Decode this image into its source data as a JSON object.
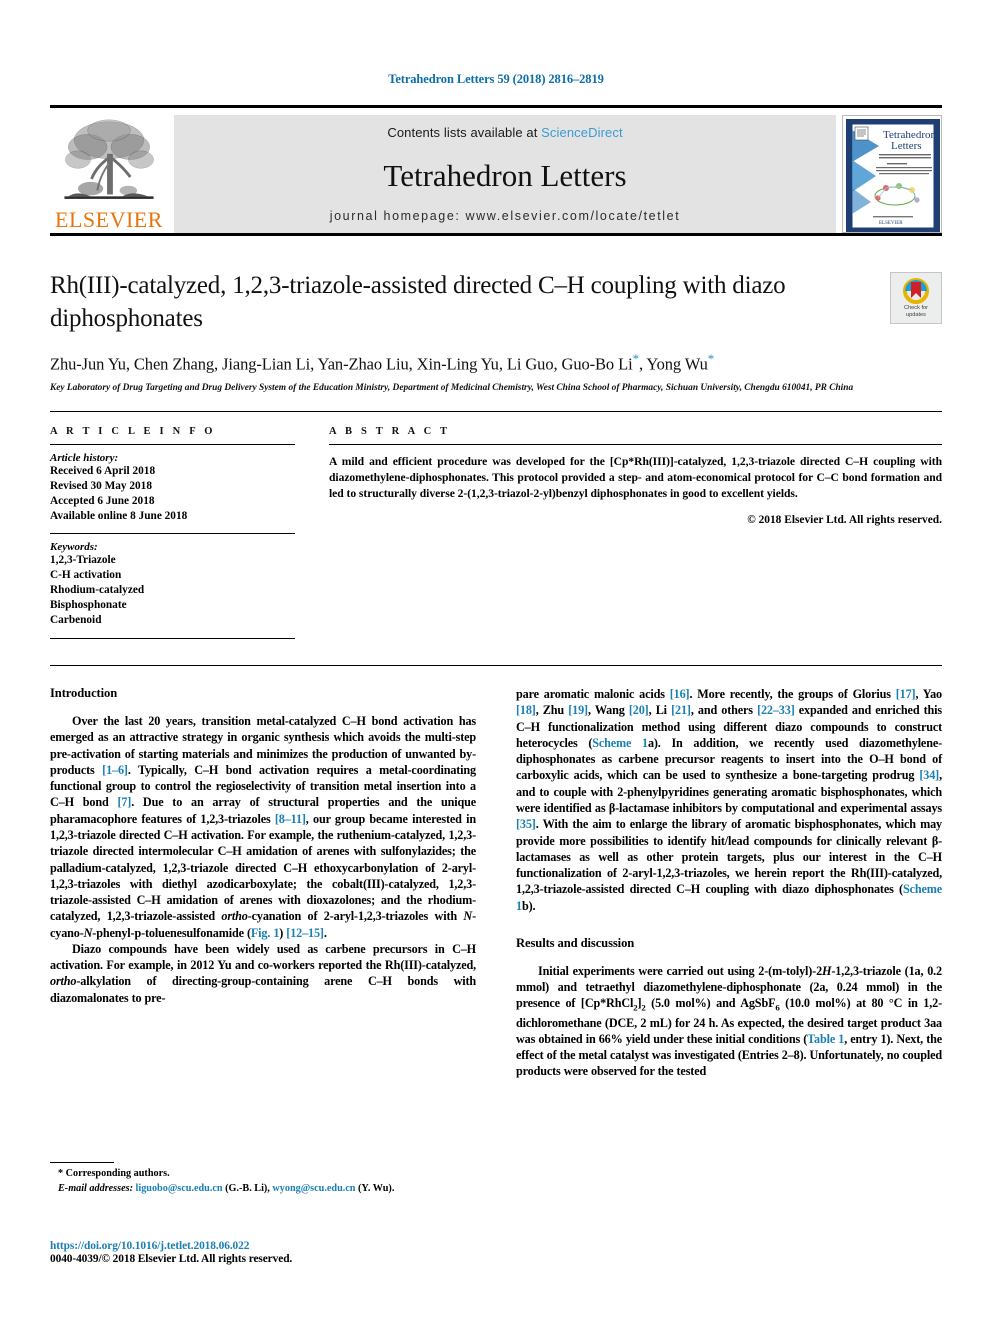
{
  "running_head": "Tetrahedron Letters 59 (2018) 2816–2819",
  "masthead": {
    "publisher_name": "ELSEVIER",
    "contents_prefix": "Contents lists available at ",
    "sciencedirect": "ScienceDirect",
    "journal_title": "Tetrahedron Letters",
    "homepage": "journal homepage: www.elsevier.com/locate/tetlet",
    "cover_title_line1": "Tetrahedron",
    "cover_title_line2": "Letters"
  },
  "article": {
    "title": "Rh(III)-catalyzed, 1,2,3-triazole-assisted directed C–H coupling with diazo diphosphonates",
    "crossmark_label_line1": "Check for",
    "crossmark_label_line2": "updates",
    "authors": "Zhu-Jun Yu, Chen Zhang, Jiang-Lian Li, Yan-Zhao Liu, Xin-Ling Yu, Li Guo, Guo-Bo Li",
    "authors_tail": ", Yong Wu",
    "affiliation": "Key Laboratory of Drug Targeting and Drug Delivery System of the Education Ministry, Department of Medicinal Chemistry, West China School of Pharmacy, Sichuan University, Chengdu 610041, PR China"
  },
  "article_info": {
    "heading": "A R T I C L E   I N F O",
    "history_label": "Article history:",
    "history": [
      "Received 6 April 2018",
      "Revised 30 May 2018",
      "Accepted 6 June 2018",
      "Available online 8 June 2018"
    ],
    "keywords_label": "Keywords:",
    "keywords": [
      "1,2,3-Triazole",
      "C-H activation",
      "Rhodium-catalyzed",
      "Bisphosphonate",
      "Carbenoid"
    ]
  },
  "abstract": {
    "heading": "A B S T R A C T",
    "text": "A mild and efficient procedure was developed for the [Cp*Rh(III)]-catalyzed, 1,2,3-triazole directed C–H coupling with diazomethylene-diphosphonates. This protocol provided a step- and atom-economical protocol for C–C bond formation and led to structurally diverse 2-(1,2,3-triazol-2-yl)benzyl diphosphonates in good to excellent yields.",
    "rights": "© 2018 Elsevier Ltd. All rights reserved."
  },
  "body": {
    "intro_heading": "Introduction",
    "results_heading": "Results and discussion",
    "left_para1_a": "Over the last 20 years, transition metal-catalyzed C–H bond activation has emerged as an attractive strategy in organic synthesis which avoids the multi-step pre-activation of starting materials and minimizes the production of unwanted by-products ",
    "left_para1_r1": "[1–6]",
    "left_para1_b": ". Typically, C–H bond activation requires a metal-coordinating functional group to control the regioselectivity of transition metal insertion into a C–H bond ",
    "left_para1_r2": "[7]",
    "left_para1_c": ". Due to an array of structural properties and the unique pharamacophore features of 1,2,3-triazoles ",
    "left_para1_r3": "[8–11]",
    "left_para1_d": ", our group became interested in 1,2,3-triazole directed C–H activation. For example, the ruthenium-catalyzed, 1,2,3-triazole directed intermolecular C–H amidation of arenes with sulfonylazides; the palladium-catalyzed, 1,2,3-triazole directed C–H ethoxycarbonylation of 2-aryl-1,2,3-triazoles with diethyl azodicarboxylate; the cobalt(III)-catalyzed, 1,2,3-triazole-assisted C–H amidation of arenes with dioxazolones; and the rhodium-catalyzed, 1,2,3-triazole-assisted ",
    "left_para1_e_ital": "ortho",
    "left_para1_f": "-cyanation of 2-aryl-1,2,3-triazoles with ",
    "left_para1_g_ital": "N",
    "left_para1_h": "-cyano-",
    "left_para1_i_ital": "N",
    "left_para1_j": "-phenyl-p-toluenesulfonamide (",
    "left_para1_r4": "Fig. 1",
    "left_para1_k": ") ",
    "left_para1_r5": "[12–15]",
    "left_para1_l": ".",
    "left_para2_a": "Diazo compounds have been widely used as carbene precursors in C–H activation. For example, in 2012 Yu and co-workers reported the Rh(III)-catalyzed, ",
    "left_para2_b_ital": "ortho",
    "left_para2_c": "-alkylation of directing-group-containing arene C–H bonds with diazomalonates to pre-",
    "right_para1_a": "pare aromatic malonic acids ",
    "right_para1_r1": "[16]",
    "right_para1_b": ". More recently, the groups of Glorius ",
    "right_para1_r2": "[17]",
    "right_para1_c": ", Yao ",
    "right_para1_r3": "[18]",
    "right_para1_d": ", Zhu ",
    "right_para1_r4": "[19]",
    "right_para1_e": ", Wang ",
    "right_para1_r5": "[20]",
    "right_para1_f": ", Li ",
    "right_para1_r6": "[21]",
    "right_para1_g": ", and others ",
    "right_para1_r7": "[22–33]",
    "right_para1_h": " expanded and enriched this C–H functionalization method using different diazo compounds to construct heterocycles (",
    "right_para1_r8": "Scheme 1",
    "right_para1_i": "a). In addition, we recently used diazomethylene-diphosphonates as carbene precursor reagents to insert into the O–H bond of carboxylic acids, which can be used to synthesize a bone-targeting prodrug ",
    "right_para1_r9": "[34]",
    "right_para1_j": ", and to couple with 2-phenylpyridines generating aromatic bisphosphonates, which were identified as β-lactamase inhibitors by computational and experimental assays ",
    "right_para1_r10": "[35]",
    "right_para1_k": ". With the aim to enlarge the library of aromatic bisphosphonates, which may provide more possibilities to identify hit/lead compounds for clinically relevant β-lactamases as well as other protein targets, plus our interest in the C–H functionalization of 2-aryl-1,2,3-triazoles, we herein report the Rh(III)-catalyzed, 1,2,3-triazole-assisted directed C–H coupling with diazo diphosphonates (",
    "right_para1_r11": "Scheme 1",
    "right_para1_l": "b).",
    "right_para2_a": "Initial experiments were carried out using 2-(m-tolyl)-2",
    "right_para2_h_ital": "H",
    "right_para2_b": "-1,2,3-triazole (",
    "right_para2_bold1": "1a",
    "right_para2_c": ", 0.2 mmol) and tetraethyl diazomethylene-diphosphonate (",
    "right_para2_bold2": "2a",
    "right_para2_d": ", 0.24 mmol) in the presence of [Cp*RhCl",
    "right_para2_sub1": "2",
    "right_para2_e": "]",
    "right_para2_sub2": "2",
    "right_para2_f": " (5.0 mol%) and AgSbF",
    "right_para2_sub3": "6",
    "right_para2_g": " (10.0 mol%) at 80 °C in 1,2-dichloromethane (DCE, 2 mL) for 24 h. As expected, the desired target product ",
    "right_para2_bold3": "3aa",
    "right_para2_i": " was obtained in 66% yield under these initial conditions (",
    "right_para2_r1": "Table 1",
    "right_para2_j": ", entry 1). Next, the effect of the metal catalyst was investigated (Entries 2–8). Unfortunately, no coupled products were observed for the tested"
  },
  "footnote": {
    "corresponding": "* Corresponding authors.",
    "email_label": "E-mail addresses:",
    "email1": "liguobo@scu.edu.cn",
    "email1_attr": " (G.-B. Li), ",
    "email2": "wyong@scu.edu.cn",
    "email2_attr": " (Y. Wu)."
  },
  "doi": {
    "url": "https://doi.org/10.1016/j.tetlet.2018.06.022",
    "issn_line": "0040-4039/© 2018 Elsevier Ltd. All rights reserved."
  },
  "colors": {
    "link": "#1a7fb5",
    "running_head": "#0b6ea8",
    "elsevier_orange": "#e8740c",
    "sciencedirect": "#3a9bd4",
    "masthead_bg": "#e3e3e3"
  }
}
